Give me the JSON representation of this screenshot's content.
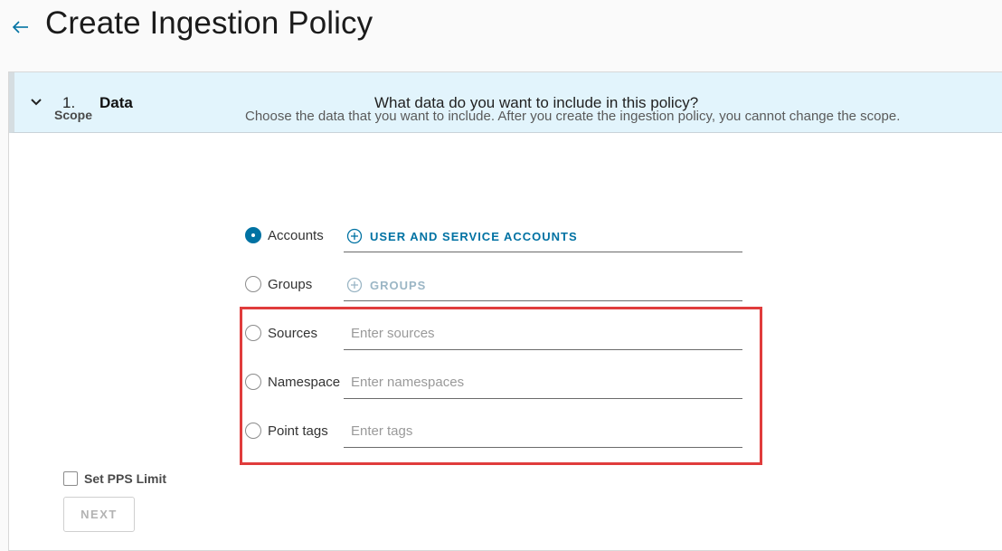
{
  "header": {
    "title": "Create Ingestion Policy",
    "back_icon": "arrow-left-icon"
  },
  "step": {
    "number": "1.",
    "name": "Data",
    "question": "What data do you want to include in this policy?",
    "expanded": true
  },
  "scope": {
    "label": "Scope",
    "help": "Choose the data that you want to include. After you create the ingestion policy, you cannot change the scope.",
    "options": [
      {
        "label": "Accounts",
        "selected": true,
        "action_label": "USER AND SERVICE ACCOUNTS"
      },
      {
        "label": "Groups",
        "selected": false,
        "action_label": "GROUPS"
      },
      {
        "label": "Sources",
        "selected": false,
        "placeholder": "Enter sources"
      },
      {
        "label": "Namespace",
        "selected": false,
        "placeholder": "Enter namespaces"
      },
      {
        "label": "Point tags",
        "selected": false,
        "placeholder": "Enter tags"
      }
    ]
  },
  "pps": {
    "label": "Set PPS Limit",
    "checked": false
  },
  "buttons": {
    "next": "NEXT"
  },
  "colors": {
    "accent": "#0072a3",
    "step_header_bg": "#e2f4fc",
    "highlight": "#e03c3c"
  }
}
